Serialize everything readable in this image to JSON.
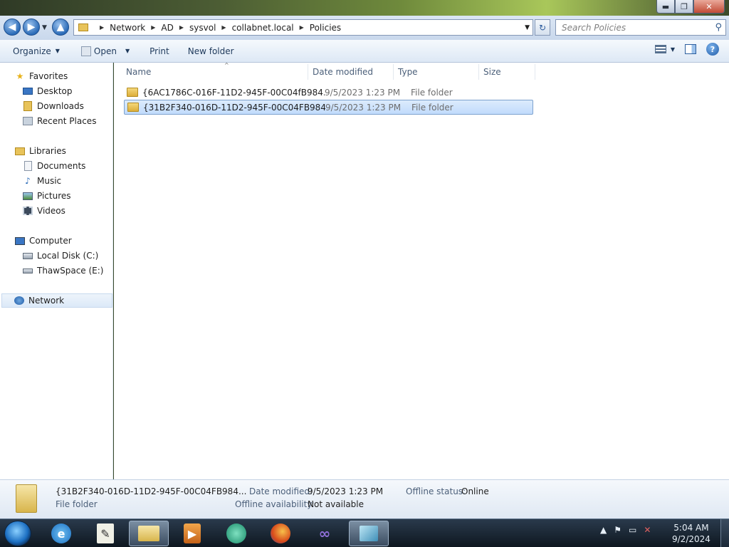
{
  "window": {
    "caption": {
      "minimize": "▬",
      "maximize": "❐",
      "close": "✕"
    }
  },
  "address_bar": {
    "back": "◀",
    "forward": "▶",
    "up": "▲",
    "breadcrumbs": [
      "Network",
      "AD",
      "sysvol",
      "collabnet.local",
      "Policies"
    ],
    "refresh": "↻",
    "search_placeholder": "Search Policies"
  },
  "command_bar": {
    "organize": "Organize",
    "open": "Open",
    "print": "Print",
    "new_folder": "New folder"
  },
  "nav_pane": {
    "favorites": {
      "label": "Favorites",
      "items": [
        "Desktop",
        "Downloads",
        "Recent Places"
      ]
    },
    "libraries": {
      "label": "Libraries",
      "items": [
        "Documents",
        "Music",
        "Pictures",
        "Videos"
      ]
    },
    "computer": {
      "label": "Computer",
      "items": [
        "Local Disk (C:)",
        "ThawSpace (E:)"
      ]
    },
    "network": {
      "label": "Network"
    }
  },
  "file_list": {
    "columns": [
      "Name",
      "Date modified",
      "Type",
      "Size"
    ],
    "rows": [
      {
        "name": "{6AC1786C-016F-11D2-945F-00C04fB984...",
        "date": "9/5/2023 1:23 PM",
        "type": "File folder",
        "size": "",
        "selected": false
      },
      {
        "name": "{31B2F340-016D-11D2-945F-00C04FB984...",
        "date": "9/5/2023 1:23 PM",
        "type": "File folder",
        "size": "",
        "selected": true
      }
    ]
  },
  "details": {
    "name": "{31B2F340-016D-11D2-945F-00C04FB984...",
    "kind": "File folder",
    "date_label": "Date modified:",
    "date_value": "9/5/2023 1:23 PM",
    "offline_avail_label": "Offline availability:",
    "offline_avail_value": "Not available",
    "offline_status_label": "Offline status:",
    "offline_status_value": "Online"
  },
  "taskbar": {
    "time": "5:04 AM",
    "date": "9/2/2024"
  }
}
